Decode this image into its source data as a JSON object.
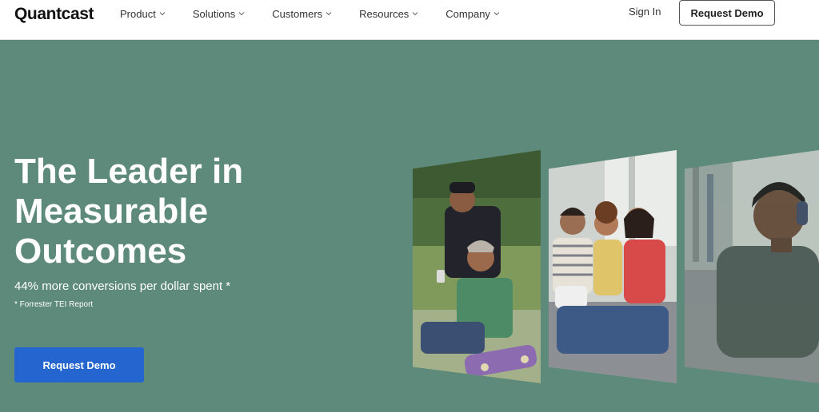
{
  "header": {
    "logo": "Quantcast",
    "nav": [
      {
        "label": "Product"
      },
      {
        "label": "Solutions"
      },
      {
        "label": "Customers"
      },
      {
        "label": "Resources"
      },
      {
        "label": "Company"
      }
    ],
    "sign_in": "Sign In",
    "request_demo": "Request Demo"
  },
  "hero": {
    "title_lines": [
      "The Leader in",
      "Measurable",
      "Outcomes"
    ],
    "subtitle": "44% more conversions per dollar spent *",
    "footnote": "* Forrester TEI Report",
    "cta": "Request Demo"
  },
  "colors": {
    "hero_bg": "#5e8a7b",
    "cta_blue": "#2465cf",
    "header_bg": "#ffffff"
  }
}
